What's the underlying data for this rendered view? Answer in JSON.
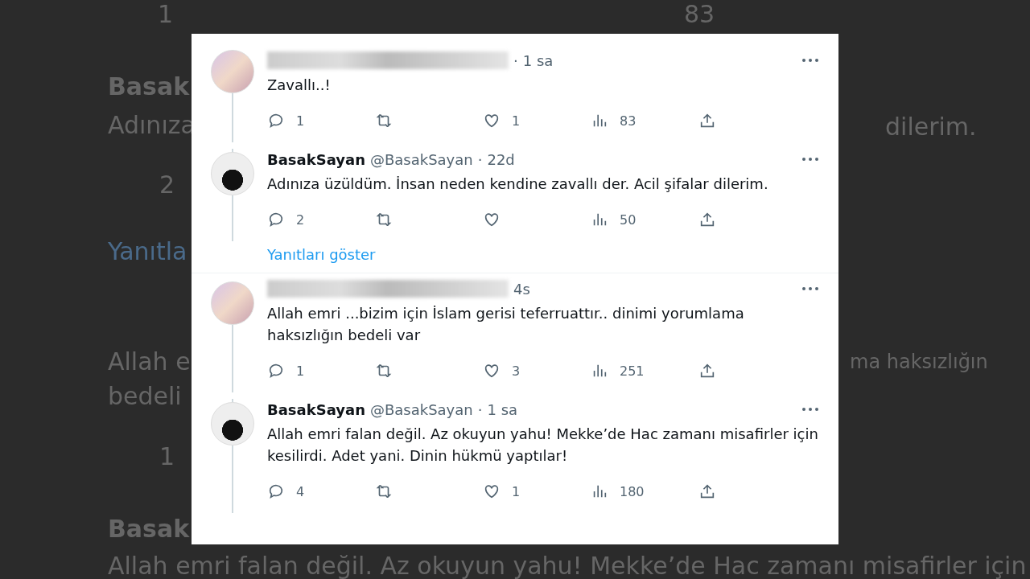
{
  "background": {
    "texts": [
      {
        "kind": "count",
        "text": "1"
      },
      {
        "kind": "count",
        "text": "83"
      },
      {
        "kind": "name",
        "text": "Basak"
      },
      {
        "kind": "body",
        "text": "Adınıza"
      },
      {
        "kind": "body-right",
        "text": "dilerim."
      },
      {
        "kind": "count",
        "text": "2"
      },
      {
        "kind": "link",
        "text": "Yanıtla"
      },
      {
        "kind": "body",
        "text": "Allah e"
      },
      {
        "kind": "body-small",
        "text": "ma haksızlığın"
      },
      {
        "kind": "body",
        "text": "bedeli"
      },
      {
        "kind": "count",
        "text": "1"
      },
      {
        "kind": "name",
        "text": "Basak"
      },
      {
        "kind": "body-wide",
        "text": "Allah emri falan değil. Az okuyun yahu! Mekke’de Hac zamanı misafirler için"
      }
    ]
  },
  "tweets": [
    {
      "redacted": true,
      "separator": "·",
      "time": "1 sa",
      "text": "Zavallı..!",
      "stats": {
        "replies": "1",
        "likes": "1",
        "views": "83"
      }
    },
    {
      "redacted": false,
      "name": "BasakSayan",
      "handle": "@BasakSayan",
      "separator": "·",
      "time": "22d",
      "text": "Adınıza üzüldüm. İnsan neden kendine zavallı der. Acil şifalar dilerim.",
      "stats": {
        "replies": "2",
        "views": "50"
      },
      "show_replies": "Yanıtları göster"
    },
    {
      "redacted": true,
      "time": "4s",
      "text": "Allah emri ...bizim için İslam gerisi teferruattır.. dinimi yorumlama haksızlığın bedeli var",
      "stats": {
        "replies": "1",
        "likes": "3",
        "views": "251"
      }
    },
    {
      "redacted": false,
      "name": "BasakSayan",
      "handle": "@BasakSayan",
      "separator": "·",
      "time": "1 sa",
      "text": "Allah emri falan değil. Az okuyun yahu! Mekke’de Hac zamanı misafirler için kesilirdi. Adet yani. Dinin hükmü yaptılar!",
      "stats": {
        "replies": "4",
        "likes": "1",
        "views": "180"
      }
    }
  ]
}
